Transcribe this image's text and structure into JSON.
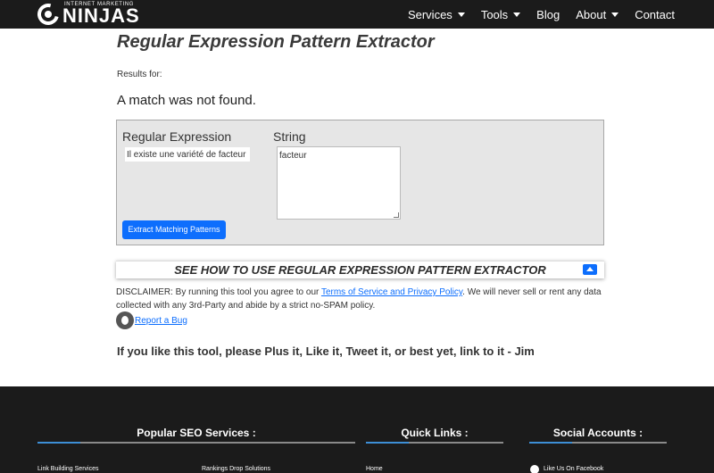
{
  "nav": {
    "logo_small": "INTERNET MARKETING",
    "logo_main": "NINJAS",
    "items": [
      {
        "label": "Services",
        "dropdown": true
      },
      {
        "label": "Tools",
        "dropdown": true
      },
      {
        "label": "Blog",
        "dropdown": false
      },
      {
        "label": "About",
        "dropdown": true
      },
      {
        "label": "Contact",
        "dropdown": false
      }
    ]
  },
  "main": {
    "title": "Regular Expression Pattern Extractor",
    "results_label": "Results for:",
    "match_message": "A match was not found.",
    "form": {
      "regex_label": "Regular Expression",
      "string_label": "String",
      "regex_value": "Il existe une variété de facteur",
      "string_value": "facteur",
      "submit_label": "Extract Matching Patterns"
    },
    "howto_label": "SEE HOW TO USE REGULAR EXPRESSION PATTERN EXTRACTOR",
    "disclaimer": {
      "prefix": "DISCLAIMER: By running this tool you agree to our ",
      "link": "Terms of Service and Privacy Policy",
      "suffix": ". We will never sell or rent any data collected with any 3rd-Party and abide by a strict no-SPAM policy."
    },
    "bug_link": "Report a Bug",
    "promo": "If you like this tool, please Plus it, Like it, Tweet it, or best yet, link to it - Jim"
  },
  "footer": {
    "popular_heading": "Popular SEO Services :",
    "quick_heading": "Quick Links :",
    "social_heading": "Social Accounts :",
    "popular_links": [
      "Link Building Services",
      "Rankings Drop Solutions"
    ],
    "quick_links": [
      "Home"
    ],
    "social_links": [
      "Like Us On Facebook"
    ]
  },
  "colors": {
    "nav_bg": "#1b1b1b",
    "accent": "#0d6efd",
    "footer_accent": "#3d8fd6"
  }
}
